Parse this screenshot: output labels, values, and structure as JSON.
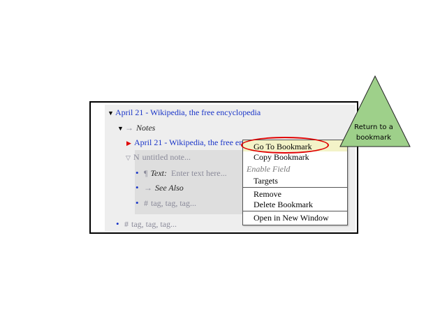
{
  "tree": {
    "root_link": "April 21 - Wikipedia, the free encyclopedia",
    "notes_glyph": "→",
    "notes_label": "Notes",
    "bookmark_link": "April 21 - Wikipedia, the free encyclopedia",
    "note_glyph": "N",
    "note_placeholder": "untitled note...",
    "text_glyph": "¶",
    "text_label": "Text:",
    "text_placeholder": "Enter text here...",
    "seealso_glyph": "→",
    "seealso_label": "See Also",
    "tags_glyph": "#",
    "tags_placeholder": "tag, tag, tag...",
    "root_tags_glyph": "#",
    "root_tags_placeholder": "tag, tag, tag..."
  },
  "context_menu": {
    "go_to_bookmark": "Go To Bookmark",
    "copy_bookmark": "Copy Bookmark",
    "enable_field": "Enable Field",
    "targets": "Targets",
    "remove": "Remove",
    "delete_bookmark": "Delete Bookmark",
    "open_in_new_window": "Open in New Window"
  },
  "callout": {
    "line1": "Return to a",
    "line2": "bookmark"
  },
  "colors": {
    "link": "#1a35c8",
    "highlight_oval": "#e00000",
    "callout_fill": "#9ed08a",
    "expand_marker": "#e00000"
  }
}
